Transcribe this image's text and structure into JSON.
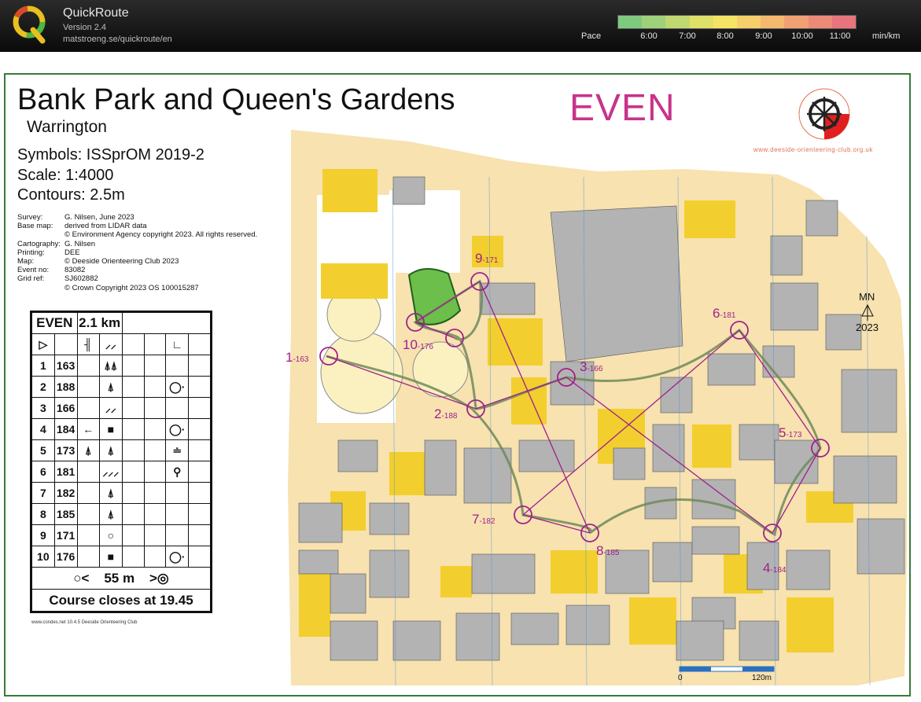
{
  "app": {
    "name": "QuickRoute",
    "version": "Version 2.4",
    "url": "matstroeng.se/quickroute/en"
  },
  "pace": {
    "label": "Pace",
    "ticks": [
      "6:00",
      "7:00",
      "8:00",
      "9:00",
      "10:00",
      "11:00"
    ],
    "unit": "min/km",
    "colors": [
      "#7fc97f",
      "#9fd07a",
      "#bfd872",
      "#dfe06a",
      "#f3e466",
      "#f6cf6a",
      "#f4b86e",
      "#f0a072",
      "#ec8a78",
      "#e8747e"
    ]
  },
  "map": {
    "title": "Bank Park and Queen's Gardens",
    "subtitle": "Warrington",
    "course_label": "EVEN",
    "symbols": "Symbols:  ISSprOM 2019-2",
    "scale": "Scale:      1:4000",
    "contours": "Contours: 2.5m",
    "meta": [
      {
        "k": "Survey:",
        "v": "G. Nilsen, June 2023"
      },
      {
        "k": "Base map:",
        "v": "derived from LIDAR data"
      },
      {
        "k": "",
        "v": "© Environment Agency copyright 2023. All rights reserved."
      },
      {
        "k": "Cartography:",
        "v": "G. Nilsen"
      },
      {
        "k": "Printing:",
        "v": "DEE"
      },
      {
        "k": "Map:",
        "v": "© Deeside Orienteering Club 2023"
      },
      {
        "k": "Event no:",
        "v": "83082"
      },
      {
        "k": "Grid ref:",
        "v": "SJ602882"
      },
      {
        "k": "",
        "v": "© Crown Copyright 2023 OS 100015287"
      }
    ],
    "club_url": "www.deeside-orienteering-club.org.uk",
    "club_name": "DEESIDE ORIENTEERING CLUB",
    "north": {
      "label": "MN",
      "year": "2023"
    },
    "scalebar": {
      "start": "0",
      "end": "120m"
    }
  },
  "descriptions": {
    "course": "EVEN",
    "length": "2.1 km",
    "controls": [
      {
        "n": "1",
        "code": "163"
      },
      {
        "n": "2",
        "code": "188"
      },
      {
        "n": "3",
        "code": "166"
      },
      {
        "n": "4",
        "code": "184"
      },
      {
        "n": "5",
        "code": "173"
      },
      {
        "n": "6",
        "code": "181"
      },
      {
        "n": "7",
        "code": "182"
      },
      {
        "n": "8",
        "code": "185"
      },
      {
        "n": "9",
        "code": "171"
      },
      {
        "n": "10",
        "code": "176"
      }
    ],
    "finish_distance": "55 m",
    "closing": "Course closes at 19.45",
    "byline": "www.condes.net 10.4.5 Deeside Orienteering Club"
  },
  "map_controls": [
    {
      "n": "1",
      "code": "163"
    },
    {
      "n": "2",
      "code": "188"
    },
    {
      "n": "3",
      "code": "166"
    },
    {
      "n": "4",
      "code": "184"
    },
    {
      "n": "5",
      "code": "173"
    },
    {
      "n": "6",
      "code": "181"
    },
    {
      "n": "7",
      "code": "182"
    },
    {
      "n": "8",
      "code": "185"
    },
    {
      "n": "9",
      "code": "171"
    },
    {
      "n": "10",
      "code": "176"
    }
  ],
  "colors": {
    "course": "#a0208a",
    "route": "#6f8a5a",
    "building": "#b3b3b3",
    "open": "#f2cf2e",
    "paved": "#f7e2b0",
    "water_blue": "#3aa0e0"
  }
}
